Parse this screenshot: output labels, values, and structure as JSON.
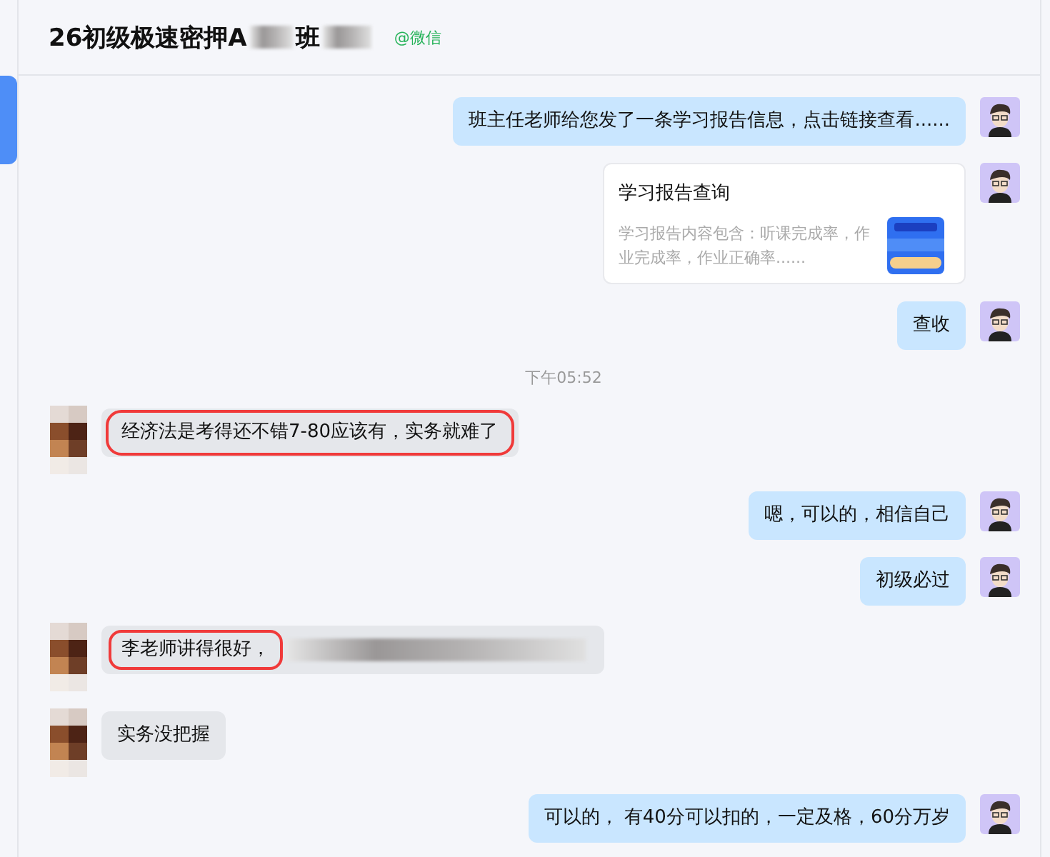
{
  "header": {
    "title_parts": [
      {
        "kind": "text",
        "text": "26初级极速密押A"
      },
      {
        "kind": "redacted"
      },
      {
        "kind": "text",
        "text": "班"
      },
      {
        "kind": "redacted"
      }
    ],
    "tag": "@微信"
  },
  "messages": [
    {
      "kind": "outgoing",
      "text": "班主任老师给您发了一条学习报告信息，点击链接查看......"
    },
    {
      "kind": "card",
      "title": "学习报告查询",
      "description": "学习报告内容包含：听课完成率，作业完成率，作业正确率......"
    },
    {
      "kind": "outgoing",
      "text": "查收"
    },
    {
      "kind": "time",
      "text": "下午05:52"
    },
    {
      "kind": "incoming",
      "text": "经济法是考得还不错7-80应该有，实务就难了",
      "highlighted": true,
      "redacted_tail": false
    },
    {
      "kind": "outgoing",
      "text": "嗯，可以的，相信自己"
    },
    {
      "kind": "outgoing",
      "text": "初级必过"
    },
    {
      "kind": "incoming",
      "text": "李老师讲得很好，",
      "highlighted": true,
      "redacted_tail": true
    },
    {
      "kind": "incoming",
      "text": "实务没把握",
      "highlighted": false,
      "redacted_tail": false
    },
    {
      "kind": "outgoing",
      "text": "可以的， 有40分可以扣的，一定及格，60分万岁"
    }
  ]
}
